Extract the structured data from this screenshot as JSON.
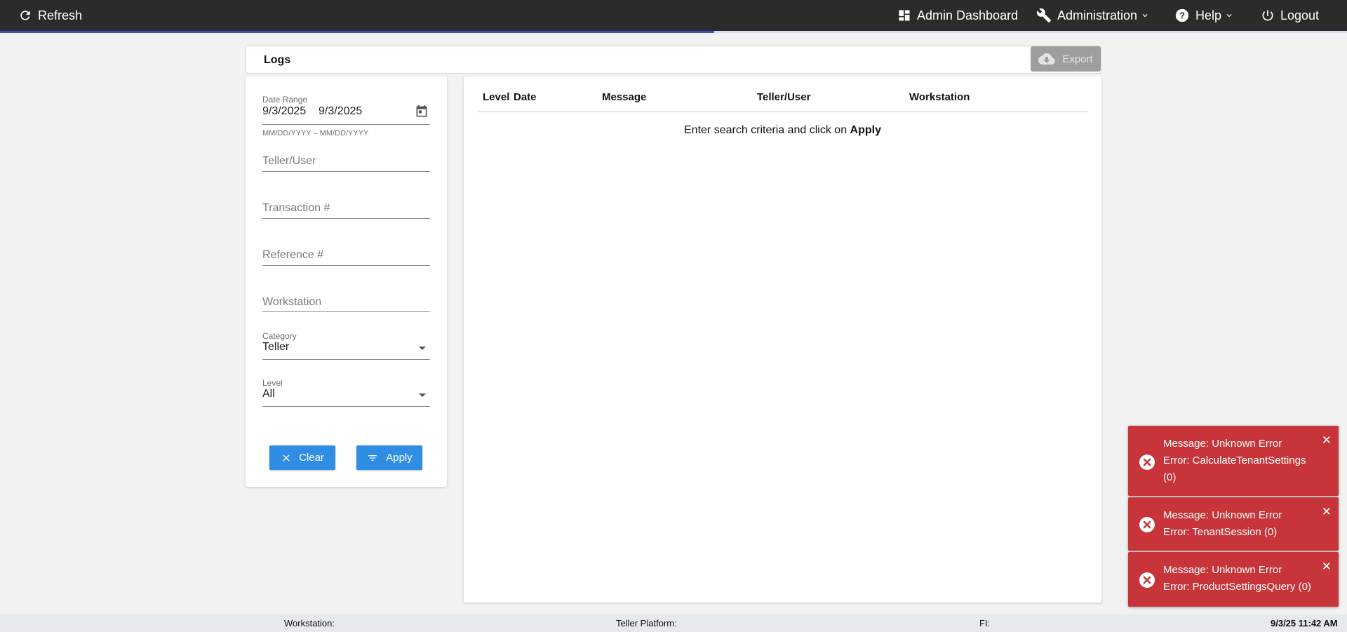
{
  "topbar": {
    "refresh_label": "Refresh",
    "admin_dashboard_label": "Admin Dashboard",
    "administration_label": "Administration",
    "help_label": "Help",
    "logout_label": "Logout",
    "loading_progress": 0.53
  },
  "page": {
    "title": "Logs",
    "export_label": "Export"
  },
  "filters": {
    "date_range_label": "Date Range",
    "start_date": "9/3/2025",
    "end_date": "9/3/2025",
    "date_hint": "MM/DD/YYYY – MM/DD/YYYY",
    "teller_user_placeholder": "Teller/User",
    "transaction_placeholder": "Transaction #",
    "reference_placeholder": "Reference #",
    "workstation_placeholder": "Workstation",
    "category_label": "Category",
    "category_value": "Teller",
    "level_label": "Level",
    "level_value": "All",
    "clear_label": "Clear",
    "apply_label": "Apply"
  },
  "results": {
    "columns": [
      "Level",
      "Date",
      "Message",
      "Teller/User",
      "Workstation"
    ],
    "empty_prefix": "Enter search criteria and click on ",
    "empty_action": "Apply"
  },
  "statusbar": {
    "workstation_label": "Workstation:",
    "teller_platform_label": "Teller Platform:",
    "fi_label": "FI:",
    "datetime": "9/3/25 11:42 AM"
  },
  "toasts": [
    {
      "line1": "Message: Unknown Error",
      "line2": "Error: CalculateTenantSettings",
      "line3": "(0)"
    },
    {
      "line1": "Message: Unknown Error",
      "line2": "Error: TenantSession (0)"
    },
    {
      "line1": "Message: Unknown Error",
      "line2": "Error: ProductSettingsQuery (0)"
    }
  ],
  "colors": {
    "topbar_bg": "#2b2b2b",
    "progress": "#3c4fd6",
    "primary_button": "#2f8de4",
    "export_disabled": "#9e9e9e",
    "toast_error": "#c7353a",
    "page_bg": "#f2f2f2"
  },
  "icons": {
    "refresh": "refresh-icon",
    "dashboard": "dashboard-icon",
    "administration": "wrench-icon",
    "help": "help-circle-icon",
    "logout": "power-icon",
    "export": "cloud-download-icon",
    "calendar": "calendar-icon",
    "clear": "close-icon",
    "apply": "filter-icon",
    "toast_error": "error-circle-icon",
    "toast_close": "close-icon"
  }
}
